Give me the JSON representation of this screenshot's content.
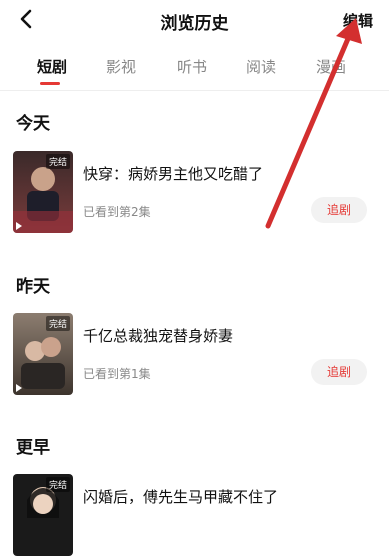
{
  "header": {
    "title": "浏览历史",
    "edit_label": "编辑"
  },
  "tabs": [
    {
      "label": "短剧",
      "active": true
    },
    {
      "label": "影视",
      "active": false
    },
    {
      "label": "听书",
      "active": false
    },
    {
      "label": "阅读",
      "active": false
    },
    {
      "label": "漫画",
      "active": false
    }
  ],
  "sections": [
    {
      "title": "今天",
      "items": [
        {
          "title": "快穿：病娇男主他又吃醋了",
          "progress": "已看到第2集",
          "badge": "完结",
          "button": "追剧"
        }
      ]
    },
    {
      "title": "昨天",
      "items": [
        {
          "title": "千亿总裁独宠替身娇妻",
          "progress": "已看到第1集",
          "badge": "完结",
          "button": "追剧"
        }
      ]
    },
    {
      "title": "更早",
      "items": [
        {
          "title": "闪婚后，傅先生马甲藏不住了",
          "badge": "完结"
        }
      ]
    }
  ],
  "colors": {
    "accent": "#e53935",
    "arrow": "#d32f2f"
  }
}
